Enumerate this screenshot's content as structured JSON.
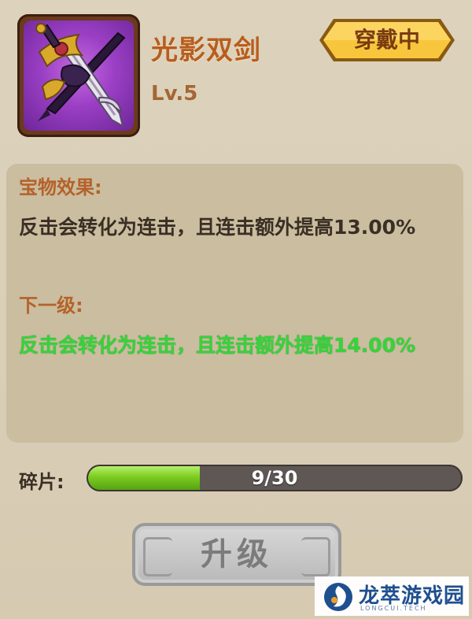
{
  "item": {
    "name": "光影双剑",
    "level": "Lv.5",
    "status_badge": "穿戴中",
    "icon": "twin-swords-icon"
  },
  "effect": {
    "title": "宝物效果:",
    "text": "反击会转化为连击，且连击额外提高13.00%",
    "next_title": "下一级:",
    "next_text": "反击会转化为连击，且连击额外提高14.00%"
  },
  "fragments": {
    "label": "碎片:",
    "current": 9,
    "required": 30,
    "progress_text": "9/30"
  },
  "upgrade": {
    "label": "升级"
  },
  "watermark": {
    "brand": "龙萃游戏园",
    "sub": "LONGCUI.TECH"
  },
  "colors": {
    "title": "#b85d1e",
    "section_title": "#b4622a",
    "next_effect": "#36d43a",
    "badge": "#f5c23a",
    "progress_fill": "#7dcc20"
  }
}
